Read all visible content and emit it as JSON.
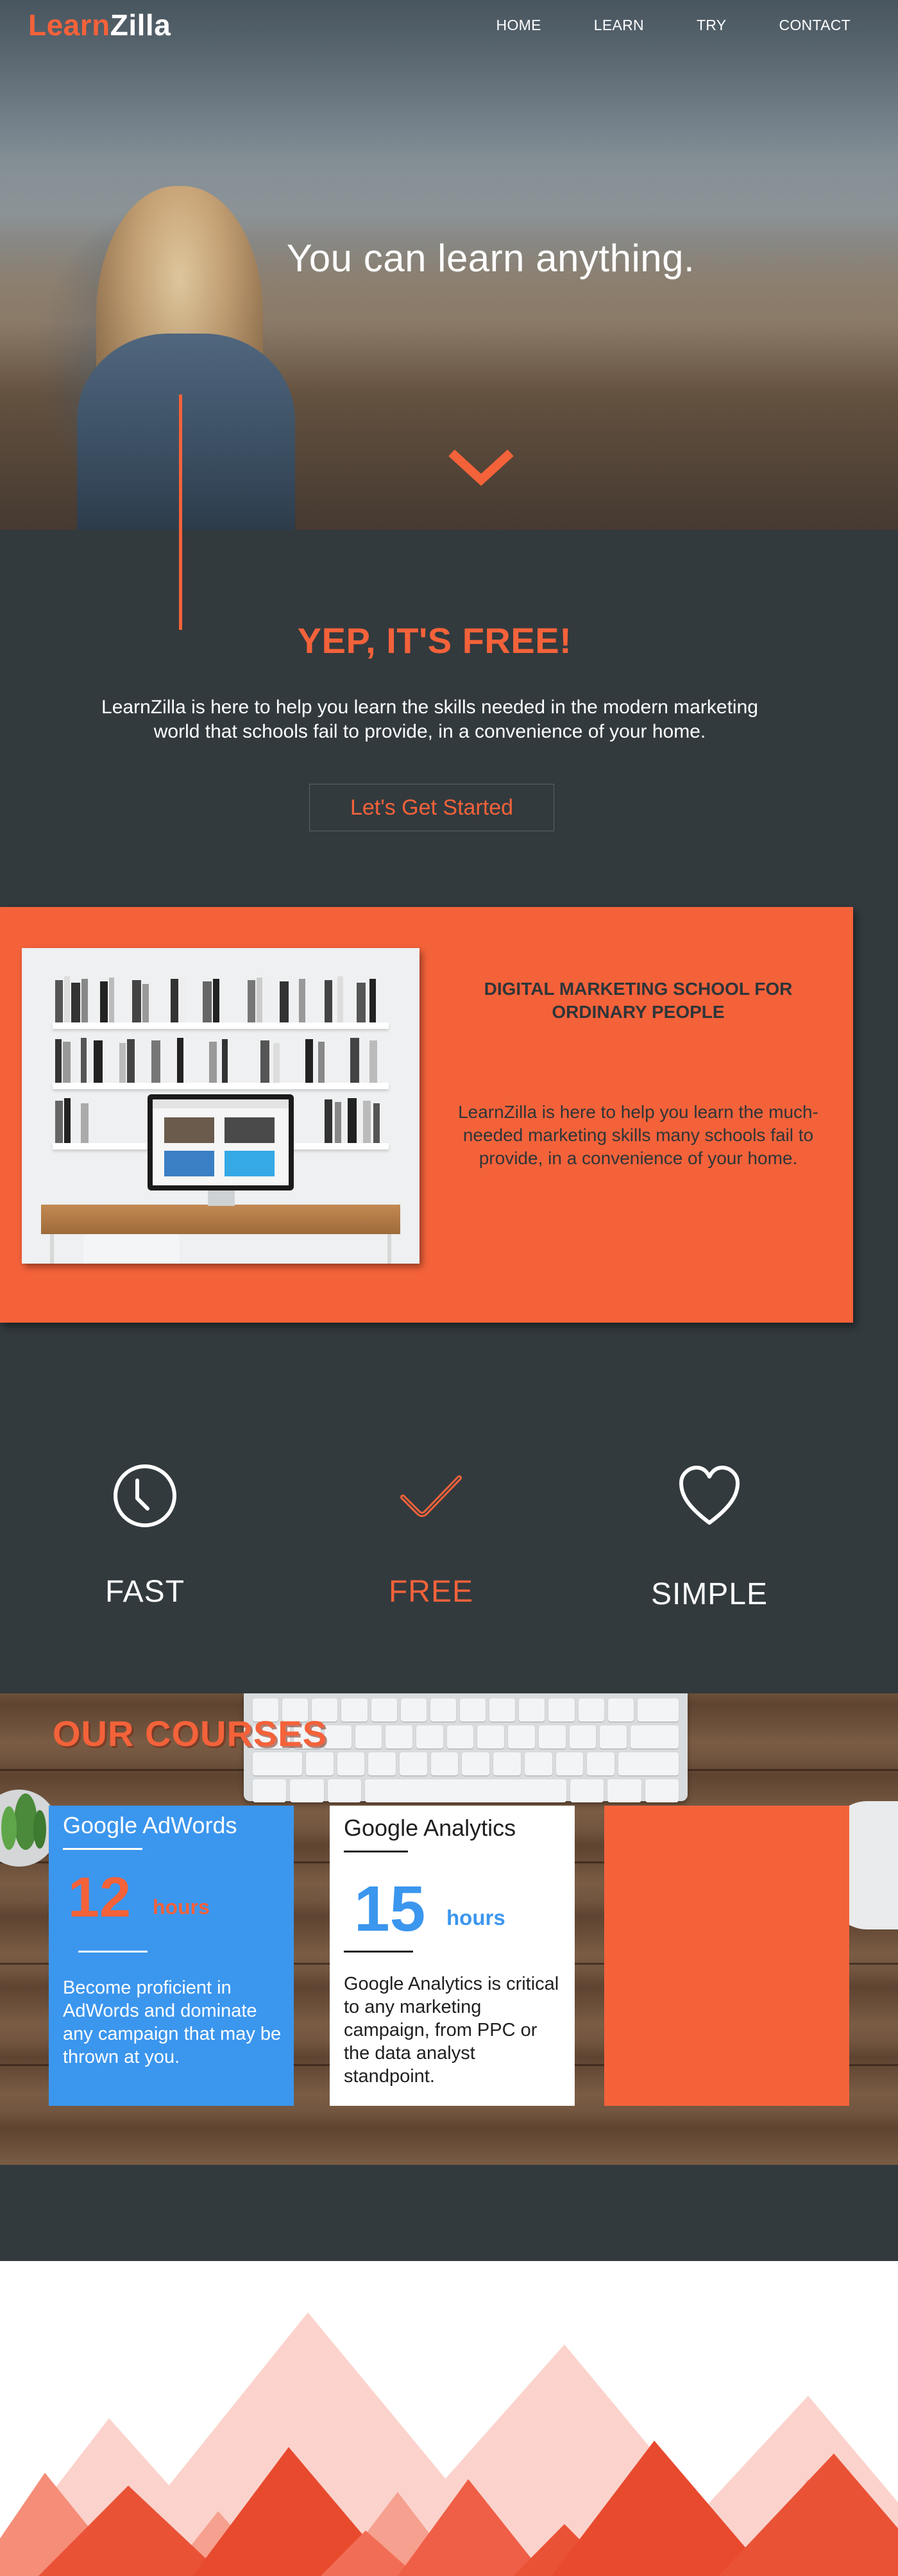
{
  "header": {
    "logo_part1": "Learn",
    "logo_part2": "Zilla",
    "nav": [
      "HOME",
      "LEARN",
      "TRY",
      "CONTACT"
    ]
  },
  "hero": {
    "title": "You can learn anything."
  },
  "intro": {
    "title": "YEP, IT'S FREE!",
    "text": "LearnZilla is here to help you learn the skills needed in the modern marketing world that schools fail to provide, in a convenience of your home.",
    "cta_label": "Let's Get Started"
  },
  "feature": {
    "title": "DIGITAL MARKETING SCHOOL FOR ORDINARY PEOPLE",
    "text": "LearnZilla is here to help you learn the much-needed marketing skills many schools fail to provide, in a convenience of your home."
  },
  "pillars": [
    {
      "label": "FAST",
      "icon": "clock-icon",
      "color": "#ffffff"
    },
    {
      "label": "FREE",
      "icon": "checkmark-icon",
      "color": "#f4623a"
    },
    {
      "label": "SIMPLE",
      "icon": "heart-icon",
      "color": "#ffffff"
    }
  ],
  "courses": {
    "title": "OUR COURSES",
    "cards": [
      {
        "name": "Google AdWords",
        "number": "12",
        "unit": "hours",
        "description": "Become proficient in AdWords and dominate any campaign that may be thrown at you."
      },
      {
        "name": "Google Analytics",
        "number": "15",
        "unit": "hours",
        "description": "Google Analytics is critical to any marketing campaign, from PPC or the data analyst standpoint."
      }
    ]
  },
  "colors": {
    "accent": "#f4623a",
    "dark": "#323a3e",
    "blue": "#3b96ee"
  }
}
